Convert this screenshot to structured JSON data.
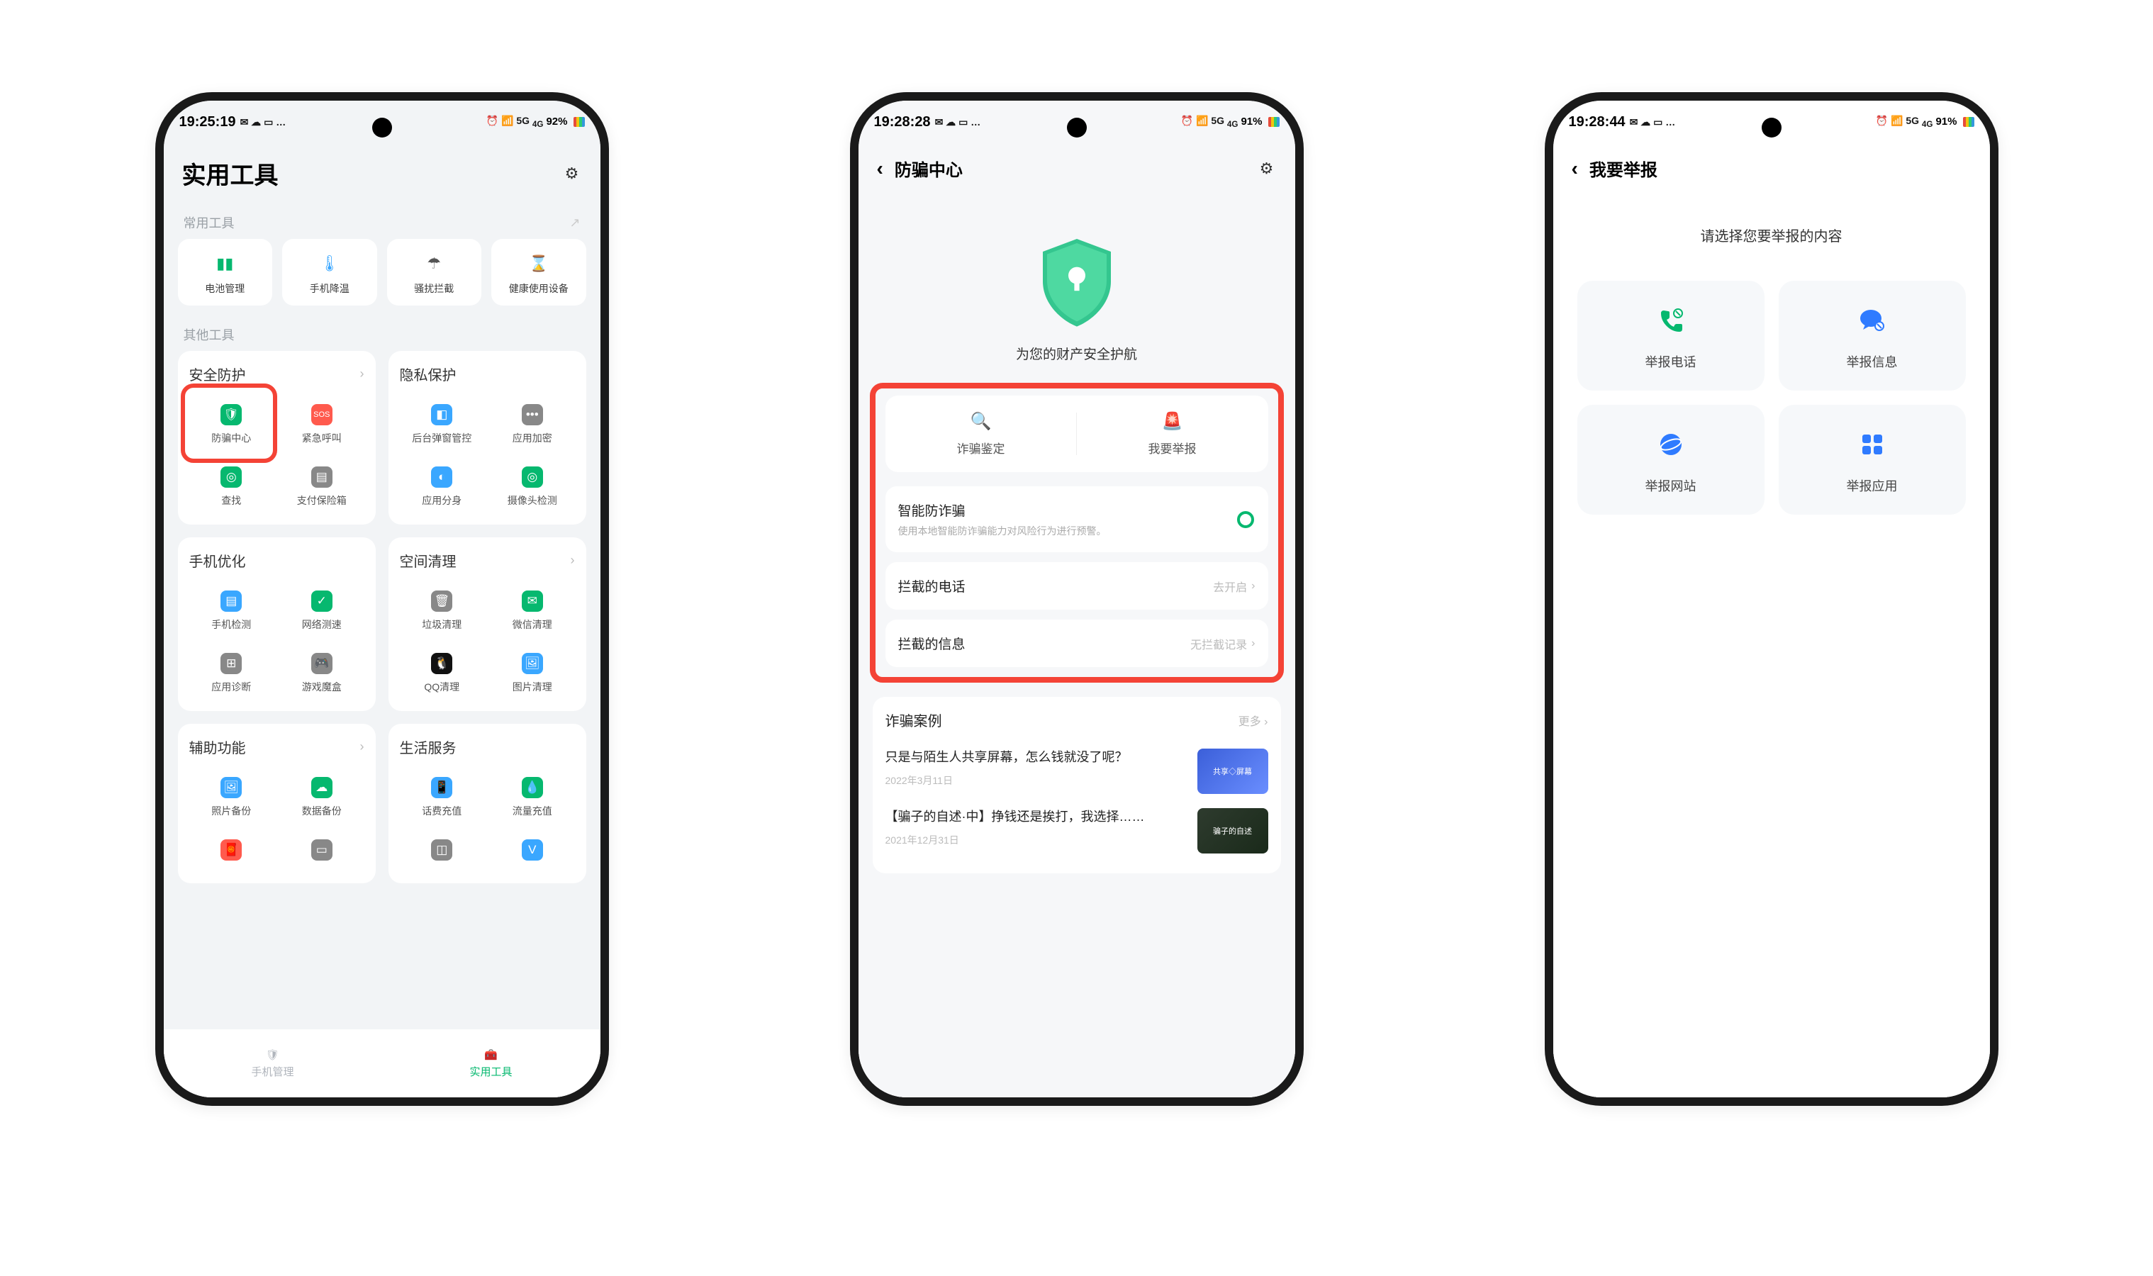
{
  "phones": {
    "p1": {
      "status": {
        "time": "19:25:19",
        "battery": "92%",
        "signal": "5G ⁴ᴳ"
      },
      "header": {
        "title": "实用工具"
      },
      "section_common": "常用工具",
      "common_tools": [
        {
          "label": "电池管理",
          "color": "#06b86f",
          "icon": "▮"
        },
        {
          "label": "手机降温",
          "color": "#3aa7ff",
          "icon": "🌡"
        },
        {
          "label": "骚扰拦截",
          "color": "#555",
          "icon": "☂"
        },
        {
          "label": "健康使用设备",
          "color": "#3aa7ff",
          "icon": "⌛"
        }
      ],
      "section_other": "其他工具",
      "cards": {
        "security": {
          "title": "安全防护",
          "items": [
            {
              "label": "防骗中心",
              "color": "#06b86f",
              "icon": "🛡"
            },
            {
              "label": "紧急呼叫",
              "color": "#ff5a4d",
              "icon": "SOS"
            },
            {
              "label": "查找",
              "color": "#06b86f",
              "icon": "◎"
            },
            {
              "label": "支付保险箱",
              "color": "#888",
              "icon": "▤"
            }
          ]
        },
        "privacy": {
          "title": "隐私保护",
          "items": [
            {
              "label": "后台弹窗管控",
              "color": "#3aa7ff",
              "icon": "◧"
            },
            {
              "label": "应用加密",
              "color": "#888",
              "icon": "•••"
            },
            {
              "label": "应用分身",
              "color": "#3aa7ff",
              "icon": "◐"
            },
            {
              "label": "摄像头检测",
              "color": "#06b86f",
              "icon": "◎"
            }
          ]
        },
        "optimize": {
          "title": "手机优化",
          "items": [
            {
              "label": "手机检测",
              "color": "#3aa7ff",
              "icon": "▤"
            },
            {
              "label": "网络测速",
              "color": "#06b86f",
              "icon": "✓"
            },
            {
              "label": "应用诊断",
              "color": "#888",
              "icon": "⊞"
            },
            {
              "label": "游戏魔盒",
              "color": "#888",
              "icon": "🎮"
            }
          ]
        },
        "cleanup": {
          "title": "空间清理",
          "items": [
            {
              "label": "垃圾清理",
              "color": "#888",
              "icon": "🗑"
            },
            {
              "label": "微信清理",
              "color": "#06b86f",
              "icon": "✉"
            },
            {
              "label": "QQ清理",
              "color": "#111",
              "icon": "🐧"
            },
            {
              "label": "图片清理",
              "color": "#3aa7ff",
              "icon": "🖼"
            }
          ]
        },
        "assist": {
          "title": "辅助功能",
          "items": [
            {
              "label": "照片备份",
              "color": "#3aa7ff",
              "icon": "🖼"
            },
            {
              "label": "数据备份",
              "color": "#06b86f",
              "icon": "☁"
            },
            {
              "label": "",
              "color": "#ff5a4d",
              "icon": "🧧"
            },
            {
              "label": "",
              "color": "#888",
              "icon": "▭"
            }
          ]
        },
        "life": {
          "title": "生活服务",
          "items": [
            {
              "label": "话费充值",
              "color": "#3aa7ff",
              "icon": "📱"
            },
            {
              "label": "流量充值",
              "color": "#06b86f",
              "icon": "💧"
            },
            {
              "label": "",
              "color": "#888",
              "icon": "◫"
            },
            {
              "label": "",
              "color": "#3aa7ff",
              "icon": "V"
            }
          ]
        }
      },
      "tabs": {
        "t1": "手机管理",
        "t2": "实用工具"
      }
    },
    "p2": {
      "status": {
        "time": "19:28:28",
        "battery": "91%"
      },
      "header": {
        "title": "防骗中心"
      },
      "shield_caption": "为您的财产安全护航",
      "actions": {
        "a1": "诈骗鉴定",
        "a2": "我要举报"
      },
      "smart": {
        "title": "智能防诈骗",
        "desc": "使用本地智能防诈骗能力对风险行为进行预警。"
      },
      "row_calls": {
        "t": "拦截的电话",
        "v": "去开启"
      },
      "row_msgs": {
        "t": "拦截的信息",
        "v": "无拦截记录"
      },
      "cases": {
        "title": "诈骗案例",
        "more": "更多",
        "a1": {
          "title": "只是与陌生人共享屏幕，怎么钱就没了呢？",
          "date": "2022年3月11日",
          "thumb": "共享◇屏幕"
        },
        "a2": {
          "title": "【骗子的自述·中】挣钱还是挨打，我选择……",
          "date": "2021年12月31日",
          "thumb": "骗子的自述"
        }
      }
    },
    "p3": {
      "status": {
        "time": "19:28:44",
        "battery": "91%"
      },
      "header": {
        "title": "我要举报"
      },
      "prompt": "请选择您要举报的内容",
      "tiles": [
        {
          "label": "举报电话",
          "color": "#06b86f",
          "icon": "call"
        },
        {
          "label": "举报信息",
          "color": "#2f7bff",
          "icon": "msg"
        },
        {
          "label": "举报网站",
          "color": "#2f7bff",
          "icon": "globe"
        },
        {
          "label": "举报应用",
          "color": "#2f7bff",
          "icon": "apps"
        }
      ]
    }
  }
}
